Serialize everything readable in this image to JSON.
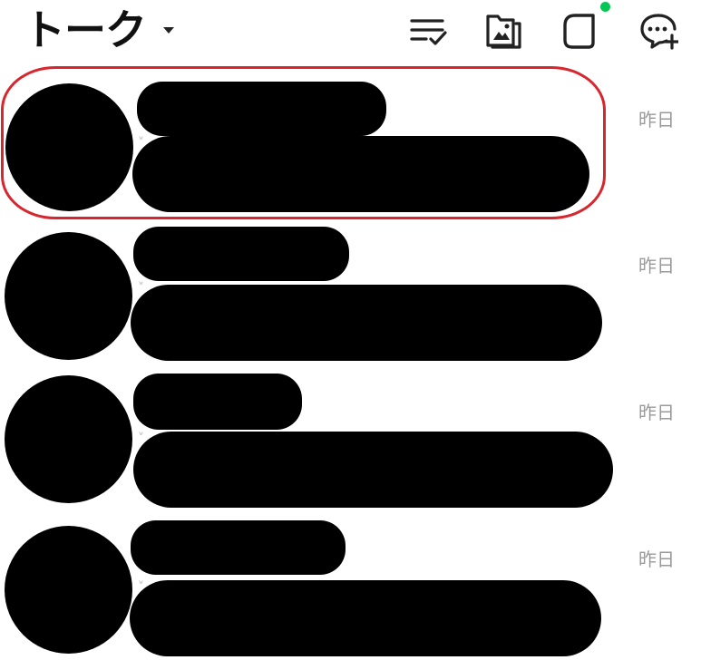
{
  "header": {
    "title": "トーク",
    "icons": [
      "sort-list-icon",
      "media-folder-icon",
      "square-rounded-icon",
      "new-chat-icon"
    ],
    "notification_color": "#06c755"
  },
  "chats": [
    {
      "name": "",
      "message": "",
      "time": "昨日"
    },
    {
      "name": "",
      "message": "",
      "time": "昨日"
    },
    {
      "name": "",
      "message": "",
      "time": "昨日"
    },
    {
      "name": "",
      "message": "",
      "time": "昨日"
    }
  ],
  "highlight": {
    "color": "#d7262e",
    "row": 0
  }
}
